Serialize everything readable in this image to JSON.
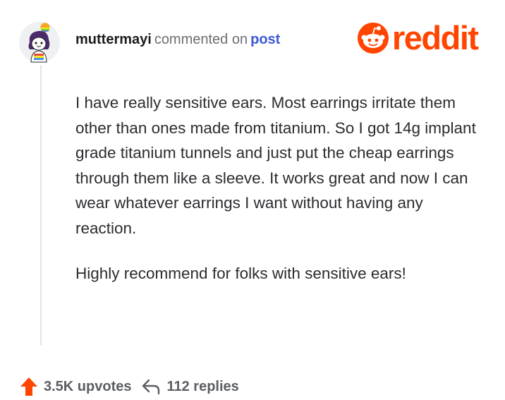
{
  "comment": {
    "username": "muttermayi",
    "action": "commented on",
    "post_link": "post",
    "body": [
      "I have really sensitive ears. Most earrings irritate them other than ones made from titanium. So I got 14g implant grade titanium tunnels and just put the cheap earrings through them like a sleeve. It works great and now I can wear whatever earrings I want without having any reaction.",
      "Highly recommend for folks with sensitive ears!"
    ]
  },
  "brand": {
    "name": "reddit",
    "color": "#ff4500"
  },
  "footer": {
    "upvotes": "3.5K upvotes",
    "replies": "112 replies",
    "upvote_icon": "upvote-arrow-icon",
    "reply_icon": "reply-arrow-icon",
    "upvote_color": "#ff4500"
  },
  "colors": {
    "link": "#3d58d8",
    "muted": "#6b6e72",
    "thread_line": "#e3e4e6"
  }
}
